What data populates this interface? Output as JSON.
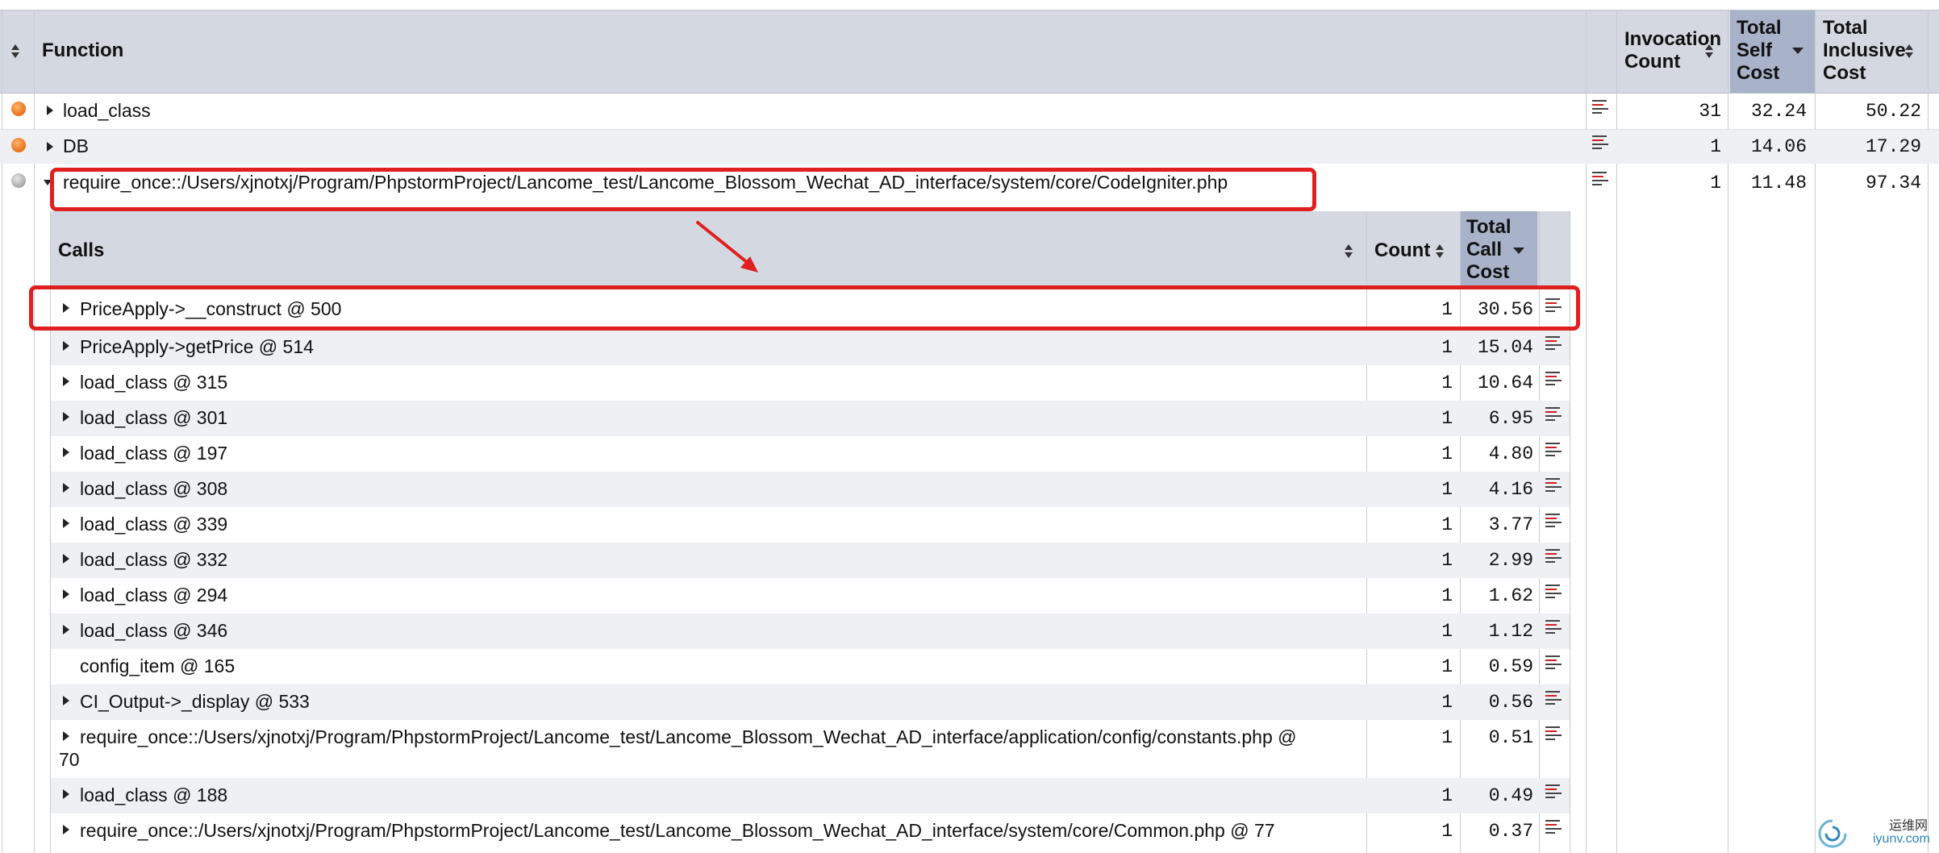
{
  "main_table": {
    "headers": {
      "function": "Function",
      "invocation_count": [
        "Invocation",
        "Count"
      ],
      "total_self_cost": [
        "Total",
        "Self",
        "Cost"
      ],
      "total_inclusive_cost": [
        "Total",
        "Inclusive",
        "Cost"
      ]
    },
    "rows": [
      {
        "name": "load_class",
        "marker": "orange",
        "invocation_count": "31",
        "self_cost": "32.24",
        "inclusive_cost": "50.22"
      },
      {
        "name": "DB",
        "marker": "orange",
        "invocation_count": "1",
        "self_cost": "14.06",
        "inclusive_cost": "17.29"
      },
      {
        "name": "require_once::/Users/xjnotxj/Program/PhpstormProject/Lancome_test/Lancome_Blossom_Wechat_AD_interface/system/core/CodeIgniter.php",
        "marker": "gray",
        "invocation_count": "1",
        "self_cost": "11.48",
        "inclusive_cost": "97.34"
      }
    ]
  },
  "calls_table": {
    "headers": {
      "calls": "Calls",
      "count": "Count",
      "total_call_cost": [
        "Total",
        "Call",
        "Cost"
      ]
    },
    "rows": [
      {
        "name": "PriceApply->__construct @ 500",
        "count": "1",
        "cost": "30.56",
        "expandable": true
      },
      {
        "name": "PriceApply->getPrice @ 514",
        "count": "1",
        "cost": "15.04",
        "expandable": true
      },
      {
        "name": "load_class @ 315",
        "count": "1",
        "cost": "10.64",
        "expandable": true
      },
      {
        "name": "load_class @ 301",
        "count": "1",
        "cost": "6.95",
        "expandable": true
      },
      {
        "name": "load_class @ 197",
        "count": "1",
        "cost": "4.80",
        "expandable": true
      },
      {
        "name": "load_class @ 308",
        "count": "1",
        "cost": "4.16",
        "expandable": true
      },
      {
        "name": "load_class @ 339",
        "count": "1",
        "cost": "3.77",
        "expandable": true
      },
      {
        "name": "load_class @ 332",
        "count": "1",
        "cost": "2.99",
        "expandable": true
      },
      {
        "name": "load_class @ 294",
        "count": "1",
        "cost": "1.62",
        "expandable": true
      },
      {
        "name": "load_class @ 346",
        "count": "1",
        "cost": "1.12",
        "expandable": true
      },
      {
        "name": "config_item @ 165",
        "count": "1",
        "cost": "0.59",
        "expandable": false
      },
      {
        "name": "CI_Output->_display @ 533",
        "count": "1",
        "cost": "0.56",
        "expandable": true
      },
      {
        "name": "require_once::/Users/xjnotxj/Program/PhpstormProject/Lancome_test/Lancome_Blossom_Wechat_AD_interface/application/config/constants.php @",
        "name_cont": "70",
        "count": "1",
        "cost": "0.51",
        "expandable": true
      },
      {
        "name": "load_class @ 188",
        "count": "1",
        "cost": "0.49",
        "expandable": true
      },
      {
        "name": "require_once::/Users/xjnotxj/Program/PhpstormProject/Lancome_test/Lancome_Blossom_Wechat_AD_interface/system/core/Common.php @ 77",
        "count": "1",
        "cost": "0.37",
        "expandable": true
      }
    ]
  },
  "watermark": {
    "text_top": "运维网",
    "text_bottom": "iyunv.com"
  },
  "colors": {
    "header": "#d4d9e1",
    "sorted_header": "#a8b2c8",
    "highlight": "#e02020",
    "marker_orange": "#e8701a",
    "marker_gray": "#a8a8a8"
  }
}
